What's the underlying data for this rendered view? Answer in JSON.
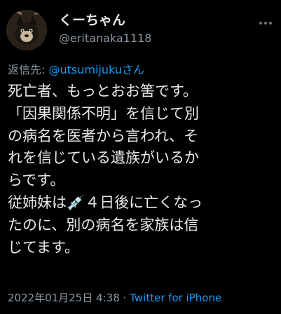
{
  "author": {
    "display_name": "くーちゃん",
    "handle": "@eritanaka1118"
  },
  "reply": {
    "prefix": "返信先: ",
    "to": "@utsumijukuさん"
  },
  "body_lines": [
    "死亡者、もっとおお筈です。",
    "「因果関係不明」を信じて別",
    "の病名を医者から言われ、そ",
    "れを信じている遺族がいるか",
    "らです。",
    "従姉妹は💉４日後に亡くなっ",
    "たのに、別の病名を家族は信",
    "じてます。"
  ],
  "meta": {
    "timestamp": "2022年01月25日 4:38",
    "separator": " · ",
    "source": "Twitter for iPhone"
  },
  "colors": {
    "background": "#000000",
    "text": "#e7e9ea",
    "secondary": "#8b98a5",
    "link": "#1d9bf0"
  },
  "icons": {
    "more": "more-horizontal-icon",
    "syringe": "syringe-emoji"
  }
}
